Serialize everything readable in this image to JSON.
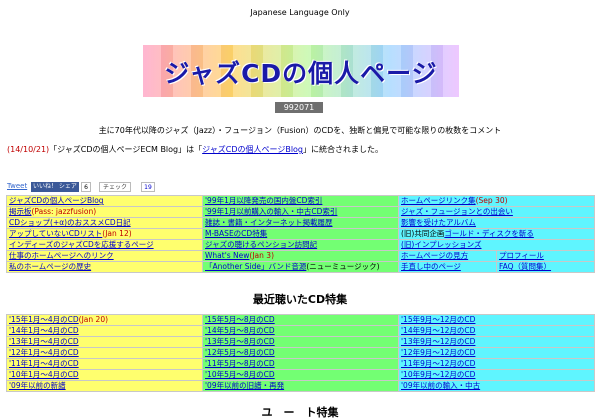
{
  "header": {
    "notice": "Japanese Language Only",
    "banner_title": "ジャズCDの個人ページ",
    "counter": "992071"
  },
  "intro": {
    "text": "主に70年代以降のジャズ（Jazz）・フュージョン（Fusion）のCDを、独断と偏見で可能な限りの枚数をコメント",
    "date": "(14/10/21)",
    "pre": "「ジャズCDの個人ページECM Blog」は「",
    "link": "ジャズCDの個人ページBlog",
    "post": "」に統合されました。"
  },
  "social": {
    "tweet": "Tweet",
    "like": "いいね！ シェア",
    "like_count": "6",
    "hatena": "チェック",
    "hatena_count": "19"
  },
  "menu": {
    "rows": [
      [
        {
          "t": "ジャズCDの個人ページBlog"
        },
        {
          "t": "'99年1月以降発売の国内盤CD索引"
        },
        {
          "t": "ホームページリンク集",
          "n": "(Sep 30)"
        }
      ],
      [
        {
          "t": "掲示板",
          "n": "(Pass: jazzfusion)"
        },
        {
          "t": "'99年1月以前購入の輸入・中古CD索引"
        },
        {
          "t": "ジャズ・フュージョンとの出会い"
        }
      ],
      [
        {
          "t": "CDショップ(+α)のおススメCD日記"
        },
        {
          "t": "雑誌・書籍・インターネット掲載履歴"
        },
        {
          "t": "影響を受けたアルバム"
        }
      ],
      [
        {
          "t": "アップしていないCDリスト",
          "n": "(Jan 12)"
        },
        {
          "t": "M-BASEのCD特集"
        },
        {
          "p": "(旧)共同企画",
          "t": "ゴールド・ディスクを斬る"
        }
      ],
      [
        {
          "t": "インディーズのジャズCDを応援するページ"
        },
        {
          "t": "ジャズの聴けるペンション訪問記"
        },
        {
          "t": "(旧)インプレッションズ"
        }
      ],
      [
        {
          "t": "仕事のホームページへのリンク"
        },
        {
          "t": "What's New",
          "n": "(Jan 3)"
        },
        {
          "t": "ホームページの見方"
        },
        {
          "t": "プロフィール"
        }
      ],
      [
        {
          "t": "私のホームページの歴史"
        },
        {
          "t": "「Another Side」バンド音源",
          "x": "(ニューミュージック)"
        },
        {
          "t": "手直し中のページ"
        },
        {
          "t": "FAQ（質問集）"
        }
      ]
    ]
  },
  "recent": {
    "title": "最近聴いたCD特集",
    "rows": [
      [
        {
          "t": "'15年1月～4月のCD",
          "n": "(Jan 20)"
        },
        {
          "t": "'15年5月～8月のCD"
        },
        {
          "t": "'15年9月～12月のCD"
        }
      ],
      [
        {
          "t": "'14年1月～4月のCD"
        },
        {
          "t": "'14年5月～8月のCD"
        },
        {
          "t": "'14年9月～12月のCD"
        }
      ],
      [
        {
          "t": "'13年1月～4月のCD"
        },
        {
          "t": "'13年5月～8月のCD"
        },
        {
          "t": "'13年9月～12月のCD"
        }
      ],
      [
        {
          "t": "'12年1月～4月のCD"
        },
        {
          "t": "'12年5月～8月のCD"
        },
        {
          "t": "'12年9月～12月のCD"
        }
      ],
      [
        {
          "t": "'11年1月～4月のCD"
        },
        {
          "t": "'11年5月～8月のCD"
        },
        {
          "t": "'11年9月～12月のCD"
        }
      ],
      [
        {
          "t": "'10年1月～4月のCD"
        },
        {
          "t": "'10年5月～8月のCD"
        },
        {
          "t": "'10年9月～12月のCD"
        }
      ],
      [
        {
          "t": "'09年以前の新譜"
        },
        {
          "t": "'09年以前の旧譜・再発"
        },
        {
          "t": "'09年以前の輸入・中古"
        }
      ]
    ]
  },
  "bottom_partial": "ユ　ー　ト特集"
}
